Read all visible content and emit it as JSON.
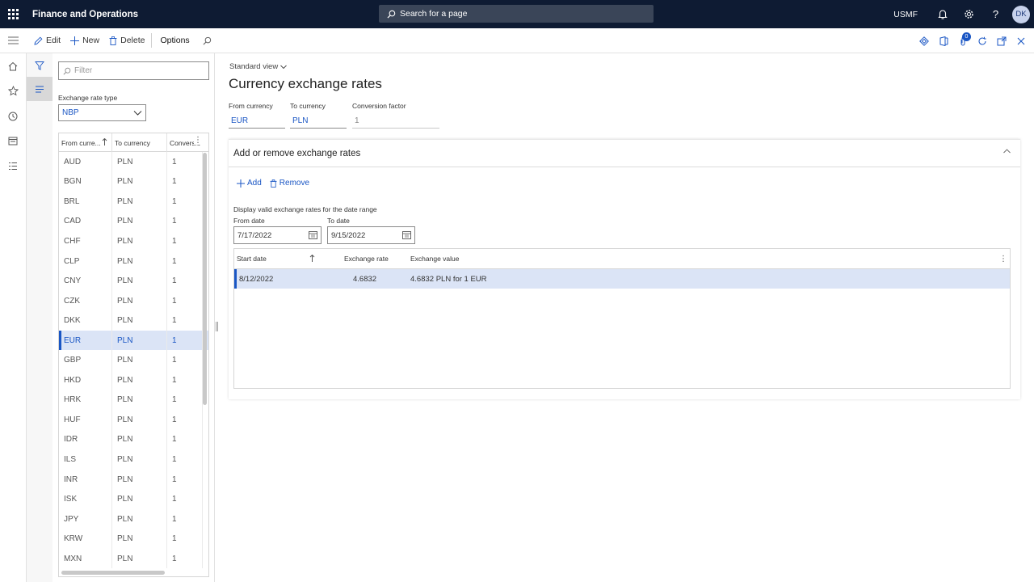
{
  "app": {
    "title": "Finance and Operations",
    "search_placeholder": "Search for a page",
    "company": "USMF",
    "user_initials": "DK"
  },
  "actions": {
    "edit": "Edit",
    "new": "New",
    "delete": "Delete",
    "options": "Options",
    "attach_count": "0"
  },
  "list_pane": {
    "filter_placeholder": "Filter",
    "rate_type_label": "Exchange rate type",
    "rate_type_value": "NBP",
    "columns": [
      "From curre...",
      "To currency",
      "Conversio"
    ],
    "rows": [
      {
        "from": "AUD",
        "to": "PLN",
        "factor": "1"
      },
      {
        "from": "BGN",
        "to": "PLN",
        "factor": "1"
      },
      {
        "from": "BRL",
        "to": "PLN",
        "factor": "1"
      },
      {
        "from": "CAD",
        "to": "PLN",
        "factor": "1"
      },
      {
        "from": "CHF",
        "to": "PLN",
        "factor": "1"
      },
      {
        "from": "CLP",
        "to": "PLN",
        "factor": "1"
      },
      {
        "from": "CNY",
        "to": "PLN",
        "factor": "1"
      },
      {
        "from": "CZK",
        "to": "PLN",
        "factor": "1"
      },
      {
        "from": "DKK",
        "to": "PLN",
        "factor": "1"
      },
      {
        "from": "EUR",
        "to": "PLN",
        "factor": "1",
        "selected": true
      },
      {
        "from": "GBP",
        "to": "PLN",
        "factor": "1"
      },
      {
        "from": "HKD",
        "to": "PLN",
        "factor": "1"
      },
      {
        "from": "HRK",
        "to": "PLN",
        "factor": "1"
      },
      {
        "from": "HUF",
        "to": "PLN",
        "factor": "1"
      },
      {
        "from": "IDR",
        "to": "PLN",
        "factor": "1"
      },
      {
        "from": "ILS",
        "to": "PLN",
        "factor": "1"
      },
      {
        "from": "INR",
        "to": "PLN",
        "factor": "1"
      },
      {
        "from": "ISK",
        "to": "PLN",
        "factor": "1"
      },
      {
        "from": "JPY",
        "to": "PLN",
        "factor": "1"
      },
      {
        "from": "KRW",
        "to": "PLN",
        "factor": "1"
      },
      {
        "from": "MXN",
        "to": "PLN",
        "factor": "1"
      }
    ]
  },
  "main": {
    "view": "Standard view",
    "title": "Currency exchange rates",
    "from_currency_label": "From currency",
    "from_currency": "EUR",
    "to_currency_label": "To currency",
    "to_currency": "PLN",
    "conversion_factor_label": "Conversion factor",
    "conversion_factor": "1",
    "fasttab": {
      "title": "Add or remove exchange rates",
      "add": "Add",
      "remove": "Remove",
      "range_note": "Display valid exchange rates for the date range",
      "from_date_label": "From date",
      "from_date": "7/17/2022",
      "to_date_label": "To date",
      "to_date": "9/15/2022",
      "columns": {
        "start_date": "Start date",
        "exchange_rate": "Exchange rate",
        "exchange_value": "Exchange value"
      },
      "rows": [
        {
          "start_date": "8/12/2022",
          "exchange_rate": "4.6832",
          "exchange_value": "4.6832 PLN for 1 EUR"
        }
      ]
    }
  }
}
